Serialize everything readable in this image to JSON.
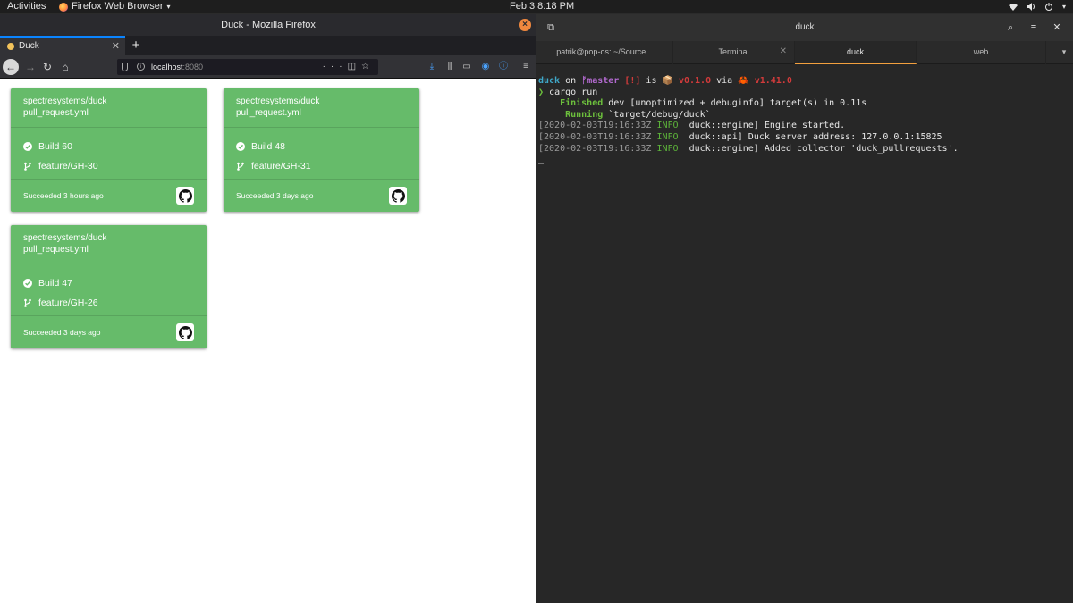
{
  "topbar": {
    "activities": "Activities",
    "app_name": "Firefox Web Browser",
    "clock": "Feb 3   8:18 PM"
  },
  "firefox": {
    "window_title": "Duck - Mozilla Firefox",
    "tab_title": "Duck",
    "url_host": "localhost",
    "url_port": ":8080"
  },
  "cards": [
    {
      "repo": "spectresystems/duck",
      "workflow": "pull_request.yml",
      "build": "Build 60",
      "branch": "feature/GH-30",
      "status": "Succeeded 3 hours ago"
    },
    {
      "repo": "spectresystems/duck",
      "workflow": "pull_request.yml",
      "build": "Build 48",
      "branch": "feature/GH-31",
      "status": "Succeeded 3 days ago"
    },
    {
      "repo": "spectresystems/duck",
      "workflow": "pull_request.yml",
      "build": "Build 47",
      "branch": "feature/GH-26",
      "status": "Succeeded 3 days ago"
    }
  ],
  "card_color": "#66bb6a",
  "terminal": {
    "window_title": "duck",
    "tabs": [
      {
        "label": "patrik@pop-os: ~/Source..."
      },
      {
        "label": "Terminal"
      },
      {
        "label": "duck"
      },
      {
        "label": "web"
      }
    ],
    "prompt": {
      "dir": "duck",
      "on": " on ",
      "branch_icon": "ᚠ",
      "branch": "master",
      "status": " [!]",
      "is": " is ",
      "pkg_icon": "📦",
      "version": " v0.1.0",
      "via": " via ",
      "rust_icon": "🦀",
      "rust_version": " v1.41.0"
    },
    "command_char": "❯",
    "command": " cargo run",
    "lines": {
      "finished_kw": "    Finished",
      "finished_rest": " dev [unoptimized + debuginfo] target(s) in 0.11s",
      "running_kw": "     Running",
      "running_rest": " `target/debug/duck`",
      "log1_ts": "[2020-02-03T19:16:33Z ",
      "log1_lvl": "INFO ",
      "log1_rest": " duck::engine] Engine started.",
      "log2_ts": "[2020-02-03T19:16:33Z ",
      "log2_lvl": "INFO ",
      "log2_rest": " duck::api] Duck server address: 127.0.0.1:15825",
      "log3_ts": "[2020-02-03T19:16:33Z ",
      "log3_lvl": "INFO ",
      "log3_rest": " duck::engine] Added collector 'duck_pullrequests'.",
      "cursor": "_"
    }
  }
}
